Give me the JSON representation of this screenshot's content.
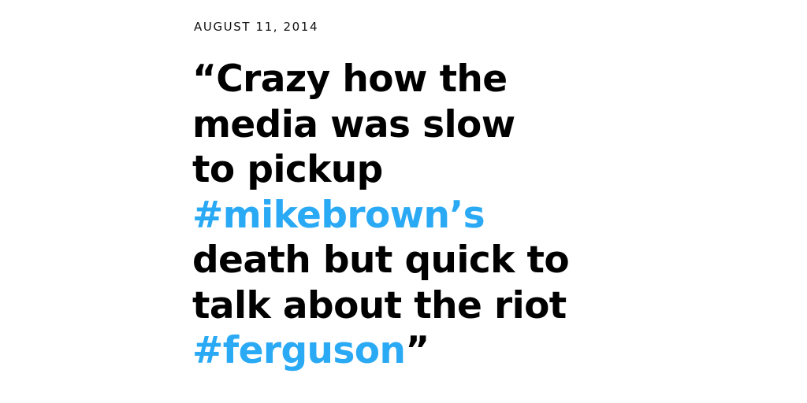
{
  "date": "AUGUST 11, 2014",
  "colors": {
    "text": "#000000",
    "hashtag": "#2aa9f5",
    "background": "#ffffff"
  },
  "quote": {
    "line1": "“Crazy how the",
    "line2": "media was slow",
    "line3": "to pickup",
    "hashtag1": "#mikebrown’s",
    "line5": "death but quick to",
    "line6": "talk about the riot",
    "hashtag2": "#ferguson",
    "closing_mark": "”"
  }
}
